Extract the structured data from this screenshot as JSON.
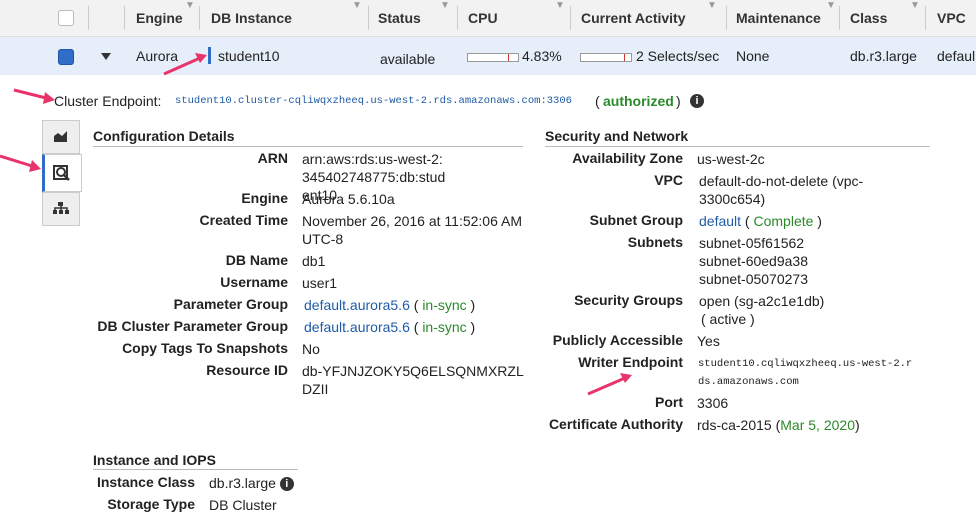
{
  "header": {
    "columns": [
      "Engine",
      "DB Instance",
      "Status",
      "CPU",
      "Current Activity",
      "Maintenance",
      "Class",
      "VPC"
    ]
  },
  "row": {
    "engine": "Aurora",
    "instance": "student10",
    "status": "available",
    "cpu": "4.83%",
    "activity": "2 Selects/sec",
    "maintenance": "None",
    "class": "db.r3.large",
    "vpc": "defaul"
  },
  "cluster": {
    "label": "Cluster Endpoint:",
    "endpoint": "student10.cluster-cqliwqxzheeq.us-west-2.rds.amazonaws.com:3306",
    "open": "(",
    "authorized": "authorized",
    "close": ")"
  },
  "config": {
    "title": "Configuration Details",
    "items": [
      {
        "label": "ARN",
        "value": "arn:aws:rds:us-west-2:345402748775:db:student10"
      },
      {
        "label": "Engine",
        "value": "Aurora 5.6.10a"
      },
      {
        "label": "Created Time",
        "value": "November 26, 2016 at 11:52:06 AM UTC-8"
      },
      {
        "label": "DB Name",
        "value": "db1"
      },
      {
        "label": "Username",
        "value": "user1"
      },
      {
        "label": "Parameter Group",
        "value": "default.aurora5.6",
        "status": "in-sync"
      },
      {
        "label": "DB Cluster Parameter Group",
        "value": "default.aurora5.6",
        "status": "in-sync"
      },
      {
        "label": "Copy Tags To Snapshots",
        "value": "No"
      },
      {
        "label": "Resource ID",
        "value": "db-YFJNJZOKY5Q6ELSQNMXRZLDZII"
      }
    ]
  },
  "security": {
    "title": "Security and Network",
    "az_label": "Availability Zone",
    "az": "us-west-2c",
    "vpc_label": "VPC",
    "vpc": "default-do-not-delete (vpc-3300c654)",
    "subnet_group_label": "Subnet Group",
    "subnet_group": "default",
    "subnet_group_status": "Complete",
    "subnets_label": "Subnets",
    "subnets": [
      "subnet-05f61562",
      "subnet-60ed9a38",
      "subnet-05070273"
    ],
    "sg_label": "Security Groups",
    "sg": "open (sg-a2c1e1db)",
    "sg_status": "( active )",
    "public_label": "Publicly Accessible",
    "public": "Yes",
    "writer_label": "Writer Endpoint",
    "writer": "student10.cqliwqxzheeq.us-west-2.rds.amazonaws.com",
    "port_label": "Port",
    "port": "3306",
    "ca_label": "Certificate Authority",
    "ca": "rds-ca-2015",
    "ca_date": "Mar 5, 2020"
  },
  "iops": {
    "title": "Instance and IOPS",
    "class_label": "Instance Class",
    "class": "db.r3.large",
    "storage_label": "Storage Type",
    "storage": "DB Cluster"
  },
  "colors": {
    "accent": "#2f6dc6",
    "link": "#1f5ba6",
    "ok": "#2a8a2a",
    "annotation": "#e8336b"
  }
}
